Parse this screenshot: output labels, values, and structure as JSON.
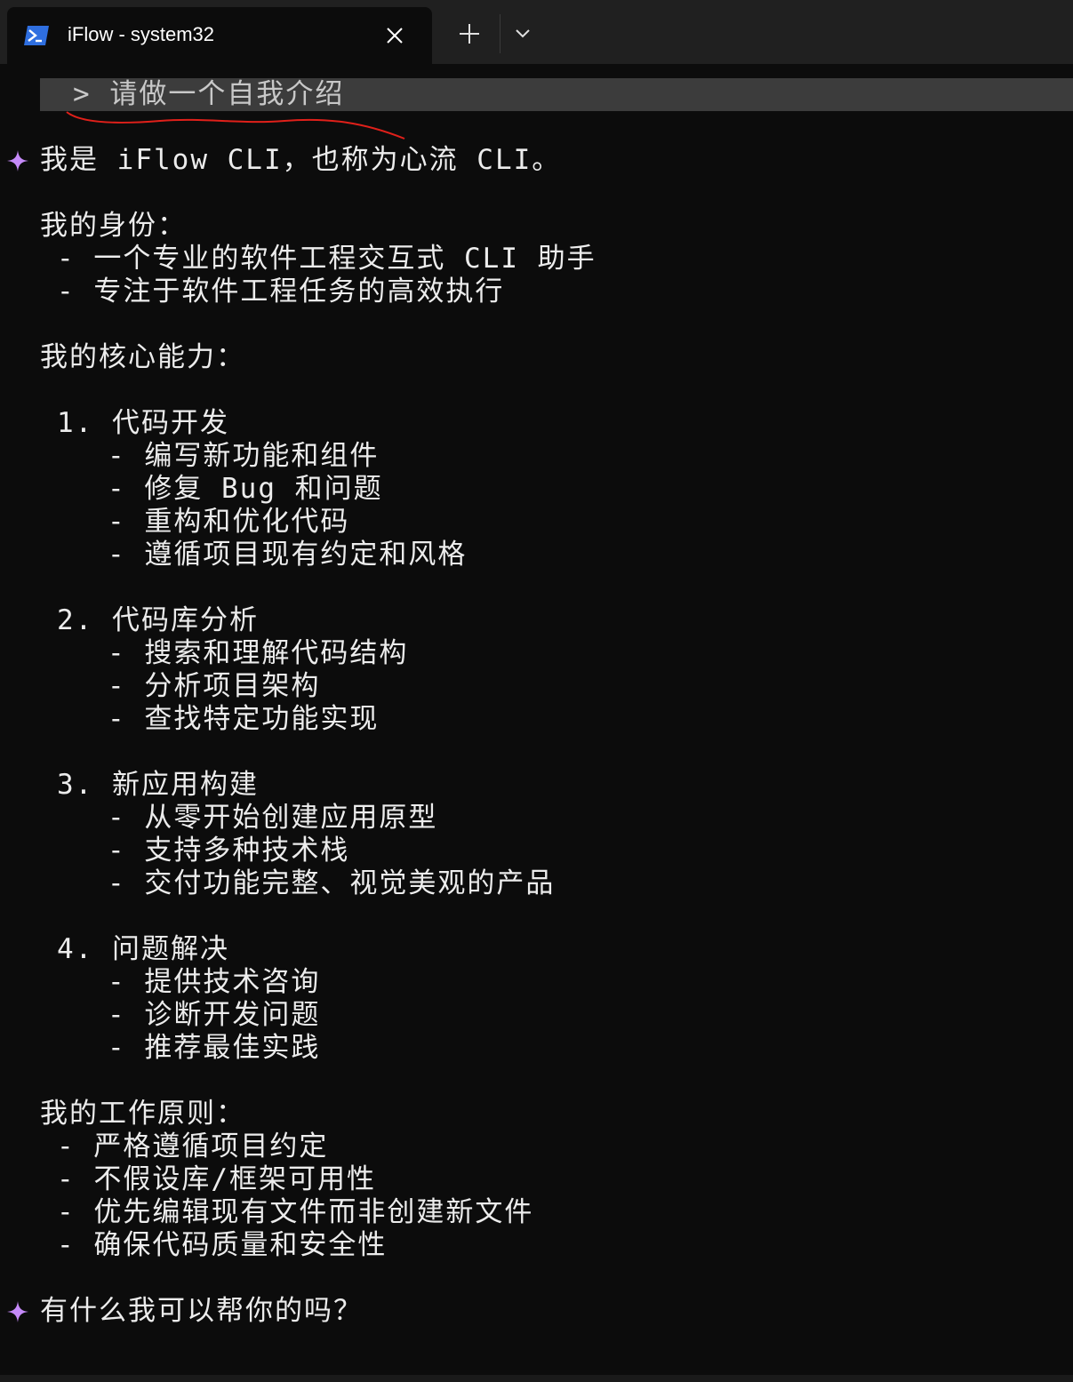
{
  "tab": {
    "title": "iFlow - system32"
  },
  "prompt": {
    "text": "> 请做一个自我介绍"
  },
  "response": {
    "intro": "我是 iFlow CLI，也称为心流 CLI。",
    "identity_heading": "我的身份：",
    "identity_items": [
      "- 一个专业的软件工程交互式 CLI 助手",
      "- 专注于软件工程任务的高效执行"
    ],
    "abilities_heading": "我的核心能力：",
    "abilities": [
      {
        "title": "1. 代码开发",
        "items": [
          "- 编写新功能和组件",
          "- 修复 Bug 和问题",
          "- 重构和优化代码",
          "- 遵循项目现有约定和风格"
        ]
      },
      {
        "title": "2. 代码库分析",
        "items": [
          "- 搜索和理解代码结构",
          "- 分析项目架构",
          "- 查找特定功能实现"
        ]
      },
      {
        "title": "3. 新应用构建",
        "items": [
          "- 从零开始创建应用原型",
          "- 支持多种技术栈",
          "- 交付功能完整、视觉美观的产品"
        ]
      },
      {
        "title": "4. 问题解决",
        "items": [
          "- 提供技术咨询",
          "- 诊断开发问题",
          "- 推荐最佳实践"
        ]
      }
    ],
    "principles_heading": "我的工作原则：",
    "principles": [
      "- 严格遵循项目约定",
      "- 不假设库/框架可用性",
      "- 优先编辑现有文件而非创建新文件",
      "- 确保代码质量和安全性"
    ],
    "closing": "有什么我可以帮你的吗？"
  },
  "colors": {
    "background": "#0c0c0c",
    "titlebar": "#202020",
    "prompt_bar": "#3c3c3c",
    "star": "#c58af9",
    "annotation": "#e0201a"
  },
  "icons": [
    "powershell-icon",
    "close-icon",
    "plus-icon",
    "chevron-down-icon",
    "sparkle-icon"
  ]
}
